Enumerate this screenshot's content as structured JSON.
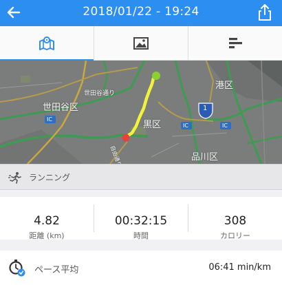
{
  "header": {
    "title": "2018/01/22 - 19:24",
    "background": "#2b8ef0"
  },
  "tabs": [
    {
      "icon": "map-icon",
      "active": true
    },
    {
      "icon": "image-icon",
      "active": false
    },
    {
      "icon": "chart-bars-icon",
      "active": false
    }
  ],
  "map": {
    "labels": {
      "setagaya_ku": "世田谷区",
      "setagaya_dori": "世田谷通り",
      "meguro_ku": "黒区",
      "minato_ku": "港区",
      "shinagawa_ku": "品川区",
      "route_ic_1": "IC",
      "route_ic_2": "IC",
      "route_ic_3": "IC",
      "route_1": "1",
      "jiyu_dori": "自由通り"
    },
    "route_start_color": "#8ad12f",
    "route_end_color": "#e8403c",
    "route_color": "#f2f23c"
  },
  "activity": {
    "name": "ランニング",
    "icon": "runner-icon"
  },
  "stats": [
    {
      "value": "4.82",
      "label": "距離 (km)"
    },
    {
      "value": "00:32:15",
      "label": "時間"
    },
    {
      "value": "308",
      "label": "カロリー"
    }
  ],
  "pace": {
    "label": "ペース平均",
    "value": "06:41 min/km",
    "icon": "pace-stopwatch-icon"
  }
}
